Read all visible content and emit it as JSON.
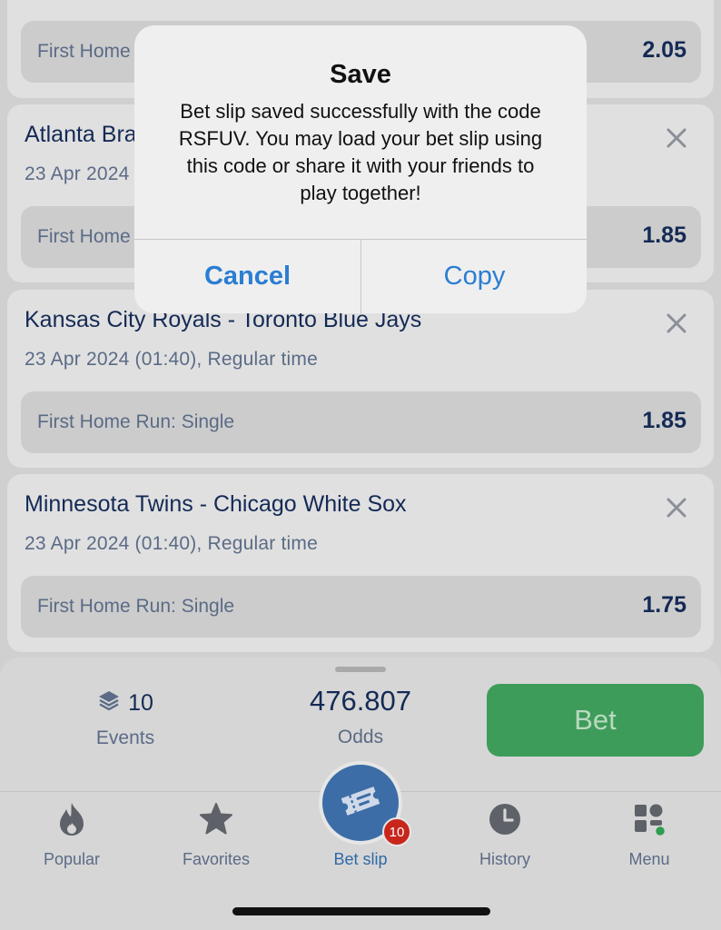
{
  "cards": [
    {
      "title": "",
      "meta": "",
      "selection": "First Home Run: Single",
      "odds": "2.05"
    },
    {
      "title": "Atlanta Braves - Houston Astros",
      "meta": "23 Apr 2024 (01:40), Regular time",
      "selection": "First Home Run: Single",
      "odds": "1.85"
    },
    {
      "title": "Kansas City Royals - Toronto Blue Jays",
      "meta": "23 Apr 2024 (01:40), Regular time",
      "selection": "First Home Run: Single",
      "odds": "1.85"
    },
    {
      "title": "Minnesota Twins - Chicago White Sox",
      "meta": "23 Apr 2024 (01:40), Regular time",
      "selection": "First Home Run: Single",
      "odds": "1.75"
    }
  ],
  "summary": {
    "events_count": "10",
    "events_label": "Events",
    "odds_value": "476.807",
    "odds_label": "Odds",
    "bet_label": "Bet"
  },
  "nav": {
    "items": [
      {
        "label": "Popular",
        "icon": "flame-icon"
      },
      {
        "label": "Favorites",
        "icon": "star-icon"
      },
      {
        "label": "Bet slip",
        "icon": "ticket-icon"
      },
      {
        "label": "History",
        "icon": "clock-icon"
      },
      {
        "label": "Menu",
        "icon": "grid-menu-icon"
      }
    ],
    "betslip_badge": "10"
  },
  "alert": {
    "title": "Save",
    "message": "Bet slip saved successfully with the code RSFUV. You may load your bet slip using this code or share it with your friends to play together!",
    "cancel_label": "Cancel",
    "copy_label": "Copy"
  },
  "colors": {
    "accent": "#2a7ed3",
    "bet_green": "#3e9c5b",
    "navy_text": "#142a55",
    "badge_red": "#c8261c"
  }
}
